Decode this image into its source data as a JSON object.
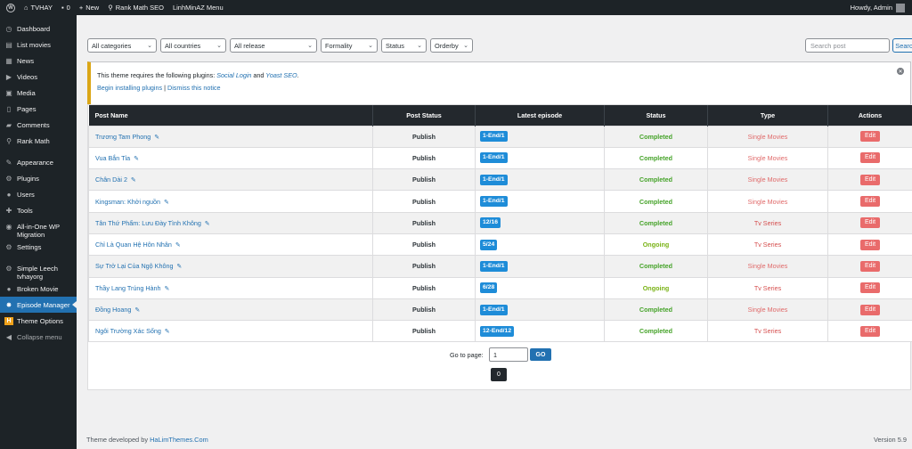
{
  "adminbar": {
    "site_name": "TVHAY",
    "comments_count": "0",
    "new_label": "New",
    "rankmath_label": "Rank Math SEO",
    "menu_label": "LinhMinAZ Menu",
    "howdy": "Howdy, Admin"
  },
  "sidebar": {
    "items": [
      {
        "label": "Dashboard",
        "icon": "dashboard-icon",
        "glyph": "◷"
      },
      {
        "label": "List movies",
        "icon": "list-icon",
        "glyph": "▤"
      },
      {
        "label": "News",
        "icon": "news-icon",
        "glyph": "▦"
      },
      {
        "label": "Videos",
        "icon": "video-icon",
        "glyph": "▶"
      },
      {
        "label": "Media",
        "icon": "media-icon",
        "glyph": "▣"
      },
      {
        "label": "Pages",
        "icon": "pages-icon",
        "glyph": "▯"
      },
      {
        "label": "Comments",
        "icon": "comments-icon",
        "glyph": "▰"
      },
      {
        "label": "Rank Math",
        "icon": "rankmath-icon",
        "glyph": "⚲"
      },
      {
        "label": "Appearance",
        "icon": "appearance-icon",
        "glyph": "✎"
      },
      {
        "label": "Plugins",
        "icon": "plugins-icon",
        "glyph": "⚙"
      },
      {
        "label": "Users",
        "icon": "users-icon",
        "glyph": "●"
      },
      {
        "label": "Tools",
        "icon": "tools-icon",
        "glyph": "✚"
      },
      {
        "label": "All-in-One WP Migration",
        "icon": "migration-icon",
        "glyph": "◉"
      },
      {
        "label": "Settings",
        "icon": "settings-icon",
        "glyph": "⚙"
      },
      {
        "label": "Simple Leech tvhayorg",
        "icon": "leech-icon",
        "glyph": "⚙"
      },
      {
        "label": "Broken Movie",
        "icon": "broken-icon",
        "glyph": "●"
      },
      {
        "label": "Episode Manager",
        "icon": "episode-icon",
        "glyph": "✸"
      },
      {
        "label": "Theme Options",
        "icon": "theme-options-icon",
        "glyph": "H"
      },
      {
        "label": "Collapse menu",
        "icon": "collapse-icon",
        "glyph": "◀"
      }
    ]
  },
  "filters": {
    "categories": "All categories",
    "countries": "All countries",
    "release": "All release",
    "formality": "Formality",
    "status": "Status",
    "orderby": "Orderby",
    "search_placeholder": "Search post",
    "search_button": "Search"
  },
  "notice": {
    "text_before": "This theme requires the following plugins: ",
    "plugin1": "Social Login",
    "and": " and ",
    "plugin2": "Yoast SEO",
    "dot": ".",
    "install_link": "Begin installing plugins",
    "separator": " | ",
    "dismiss_link": "Dismiss this notice"
  },
  "table": {
    "headers": [
      "Post Name",
      "Post Status",
      "Latest episode",
      "Status",
      "Type",
      "Actions"
    ],
    "rows": [
      {
        "name": "Trương Tam Phong",
        "post_status": "Publish",
        "episode": "1-End/1",
        "status": "Completed",
        "type": "Single Movies",
        "action": "Edit"
      },
      {
        "name": "Vua Bắn Tỉa",
        "post_status": "Publish",
        "episode": "1-End/1",
        "status": "Completed",
        "type": "Single Movies",
        "action": "Edit"
      },
      {
        "name": "Chân Dài 2",
        "post_status": "Publish",
        "episode": "1-End/1",
        "status": "Completed",
        "type": "Single Movies",
        "action": "Edit"
      },
      {
        "name": "Kingsman: Khởi nguồn",
        "post_status": "Publish",
        "episode": "1-End/1",
        "status": "Completed",
        "type": "Single Movies",
        "action": "Edit"
      },
      {
        "name": "Tân Thứ Phẩm: Lưu Đày Tình Không",
        "post_status": "Publish",
        "episode": "12/16",
        "status": "Completed",
        "type": "Tv Series",
        "action": "Edit"
      },
      {
        "name": "Chỉ Là Quan Hệ Hôn Nhân",
        "post_status": "Publish",
        "episode": "5/24",
        "status": "Ongoing",
        "type": "Tv Series",
        "action": "Edit"
      },
      {
        "name": "Sự Trở Lại Của Ngộ Không",
        "post_status": "Publish",
        "episode": "1-End/1",
        "status": "Completed",
        "type": "Single Movies",
        "action": "Edit"
      },
      {
        "name": "Thầy Lang Trúng Hành",
        "post_status": "Publish",
        "episode": "6/28",
        "status": "Ongoing",
        "type": "Tv Series",
        "action": "Edit"
      },
      {
        "name": "Đồng Hoang",
        "post_status": "Publish",
        "episode": "1-End/1",
        "status": "Completed",
        "type": "Single Movies",
        "action": "Edit"
      },
      {
        "name": "Ngôi Trường Xác Sống",
        "post_status": "Publish",
        "episode": "12-End/12",
        "status": "Completed",
        "type": "Tv Series",
        "action": "Edit"
      }
    ]
  },
  "pagination": {
    "goto_label": "Go to page:",
    "goto_value": "1",
    "go_button": "GO",
    "page_button": "0"
  },
  "footer": {
    "text": "Theme developed by ",
    "link": "HaLimThemes.Com",
    "version": "Version 5.9"
  }
}
